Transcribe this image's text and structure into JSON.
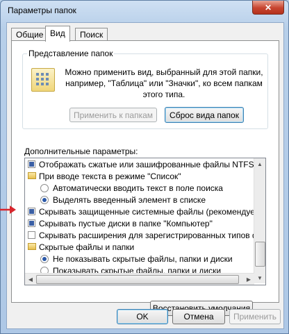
{
  "window": {
    "title": "Параметры папок",
    "close_label": "✕"
  },
  "tabs": [
    {
      "label": "Общие",
      "active": false
    },
    {
      "label": "Вид",
      "active": true
    },
    {
      "label": "Поиск",
      "active": false
    }
  ],
  "folder_view": {
    "group_title": "Представление папок",
    "description": "Можно применить вид, выбранный для этой папки, например, \"Таблица\" или \"Значки\", ко всем папкам этого типа.",
    "apply_button": "Применить к папкам",
    "reset_button": "Сброс вида папок"
  },
  "advanced": {
    "label": "Дополнительные параметры:",
    "items": [
      {
        "type": "checkbox",
        "checked": true,
        "indent": 0,
        "text": "Отображать сжатые или зашифрованные файлы NTFS д"
      },
      {
        "type": "folder",
        "indent": 0,
        "text": "При вводе текста в режиме \"Список\""
      },
      {
        "type": "radio",
        "checked": false,
        "indent": 1,
        "text": "Автоматически вводить текст в поле поиска"
      },
      {
        "type": "radio",
        "checked": true,
        "indent": 1,
        "text": "Выделять введенный элемент в списке"
      },
      {
        "type": "checkbox",
        "checked": true,
        "indent": 0,
        "text": "Скрывать защищенные системные файлы (рекомендует"
      },
      {
        "type": "checkbox",
        "checked": true,
        "indent": 0,
        "text": "Скрывать пустые диски в папке \"Компьютер\""
      },
      {
        "type": "checkbox",
        "checked": false,
        "indent": 0,
        "text": "Скрывать расширения для зарегистрированных типов ф"
      },
      {
        "type": "folder",
        "indent": 0,
        "text": "Скрытые файлы и папки"
      },
      {
        "type": "radio",
        "checked": true,
        "indent": 1,
        "text": "Не показывать скрытые файлы, папки и диски"
      },
      {
        "type": "radio",
        "checked": false,
        "indent": 1,
        "text": "Показывать скрытые файлы, папки и диски"
      }
    ],
    "restore_button": "Восстановить умолчания"
  },
  "footer": {
    "ok": "OK",
    "cancel": "Отмена",
    "apply": "Применить"
  },
  "colors": {
    "annotation_arrow": "#d8262d",
    "accent": "#3a5fa4"
  }
}
